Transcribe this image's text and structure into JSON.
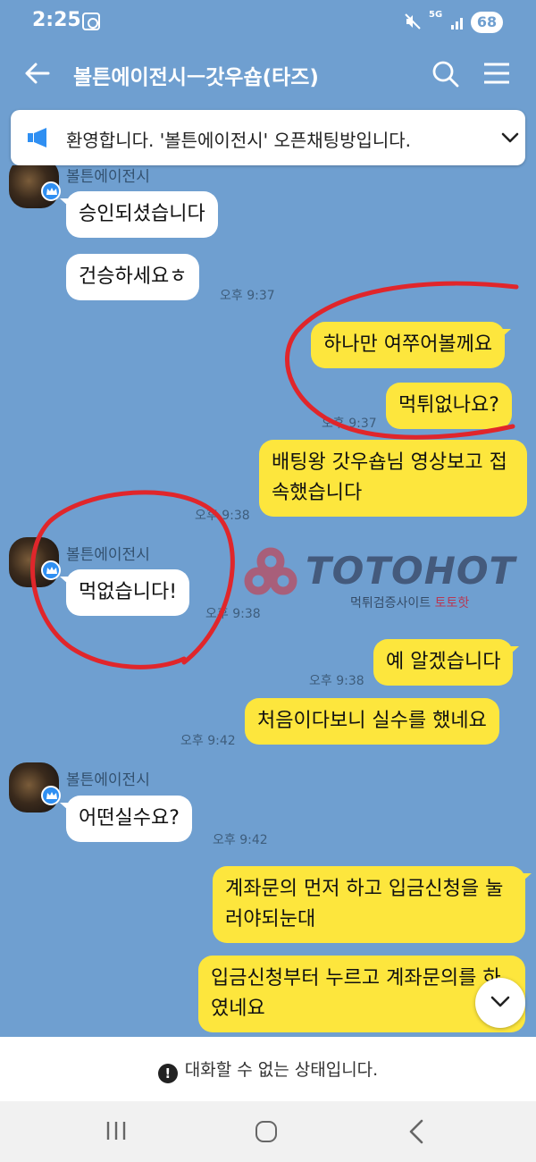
{
  "status_bar": {
    "time": "2:25",
    "network": "5G",
    "battery": "68",
    "icons": [
      "screen-record-icon",
      "mute-icon",
      "network-5g-icon",
      "signal-icon",
      "battery-icon"
    ]
  },
  "app_bar": {
    "title": "볼튼에이전시ㅡ갓우숍(타즈)",
    "icons": [
      "back-arrow-icon",
      "search-icon",
      "hamburger-menu-icon"
    ]
  },
  "notice": {
    "text": "환영합니다. '볼튼에이전시' 오픈채팅방입니다."
  },
  "messages": [
    {
      "id": "m1",
      "direction": "in",
      "sender": "볼튼에이전시",
      "text": "승인되셨습니다"
    },
    {
      "id": "m2",
      "direction": "in",
      "text": "건승하세요ㅎ",
      "time": "오후 9:37"
    },
    {
      "id": "m3",
      "direction": "out",
      "text": "하나만 여쭈어볼께요"
    },
    {
      "id": "m4",
      "direction": "out",
      "text": "먹튀없나요?",
      "time": "오후 9:37"
    },
    {
      "id": "m5",
      "direction": "out",
      "text": "배팅왕 갓우숍님 영상보고 접속했습니다",
      "time": "오후 9:38"
    },
    {
      "id": "m6",
      "direction": "in",
      "sender": "볼튼에이전시",
      "text": "먹없습니다!",
      "time": "오후 9:38"
    },
    {
      "id": "m7",
      "direction": "out",
      "text": "예 알겠습니다",
      "time": "오후 9:38"
    },
    {
      "id": "m8",
      "direction": "out",
      "text": "처음이다보니 실수를 했네요",
      "time": "오후 9:42"
    },
    {
      "id": "m9",
      "direction": "in",
      "sender": "볼튼에이전시",
      "text": "어떤실수요?",
      "time": "오후 9:42"
    },
    {
      "id": "m10",
      "direction": "out",
      "text": "계좌문의 먼저 하고 입금신청을 눌러야되눈대"
    },
    {
      "id": "m11",
      "direction": "out",
      "text": "입금신청부터 누르고 계좌문의를 하였네요"
    }
  ],
  "watermark": {
    "brand": "TOTOHOT",
    "subtitle_prefix": "먹튀검증사이트 ",
    "subtitle_accent": "토토핫"
  },
  "footer": {
    "warning_icon": "!",
    "text": "대화할 수 없는 상태입니다."
  },
  "colors": {
    "chat_background": "#6f9fd0",
    "outgoing_bubble": "#fde63d",
    "incoming_bubble": "#ffffff",
    "annotation_red": "#e0262b",
    "admin_badge": "#2f8ff2"
  }
}
